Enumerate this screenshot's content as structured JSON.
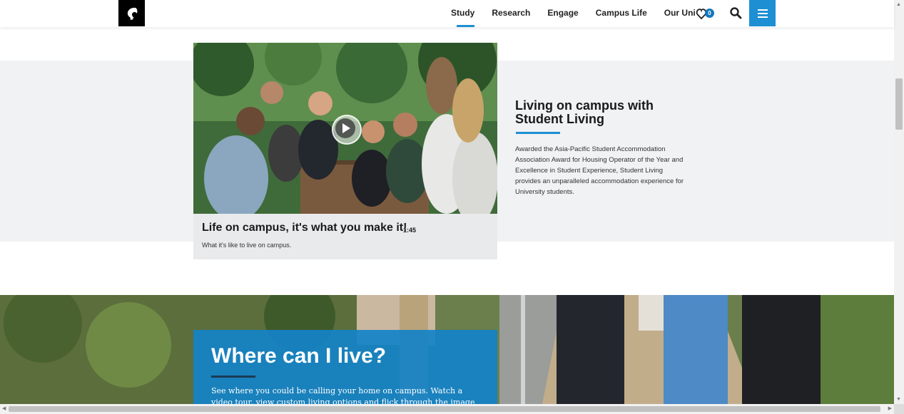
{
  "header": {
    "nav": [
      "Study",
      "Research",
      "Engage",
      "Campus Life",
      "Our Uni"
    ],
    "active_nav": "Study",
    "favourites_count": "0"
  },
  "video": {
    "title": "Life on campus, it's what you make it!",
    "duration": "1:45",
    "description": "What it's like to live on campus."
  },
  "living": {
    "title": "Living on campus with Student Living",
    "body": "Awarded the Asia-Pacific Student Accommodation Association Award for Housing Operator of the Year and Excellence in Student Experience, Student Living provides an unparalleled accommodation experience for University students."
  },
  "where": {
    "title": "Where can I live?",
    "body": "See where you could be calling your home on campus. Watch a video tour, view custom living options and flick through the image gallery for each of"
  },
  "colors": {
    "accent": "#1e8fd3",
    "band": "#f1f2f4",
    "card_blue": "#1482c8"
  }
}
